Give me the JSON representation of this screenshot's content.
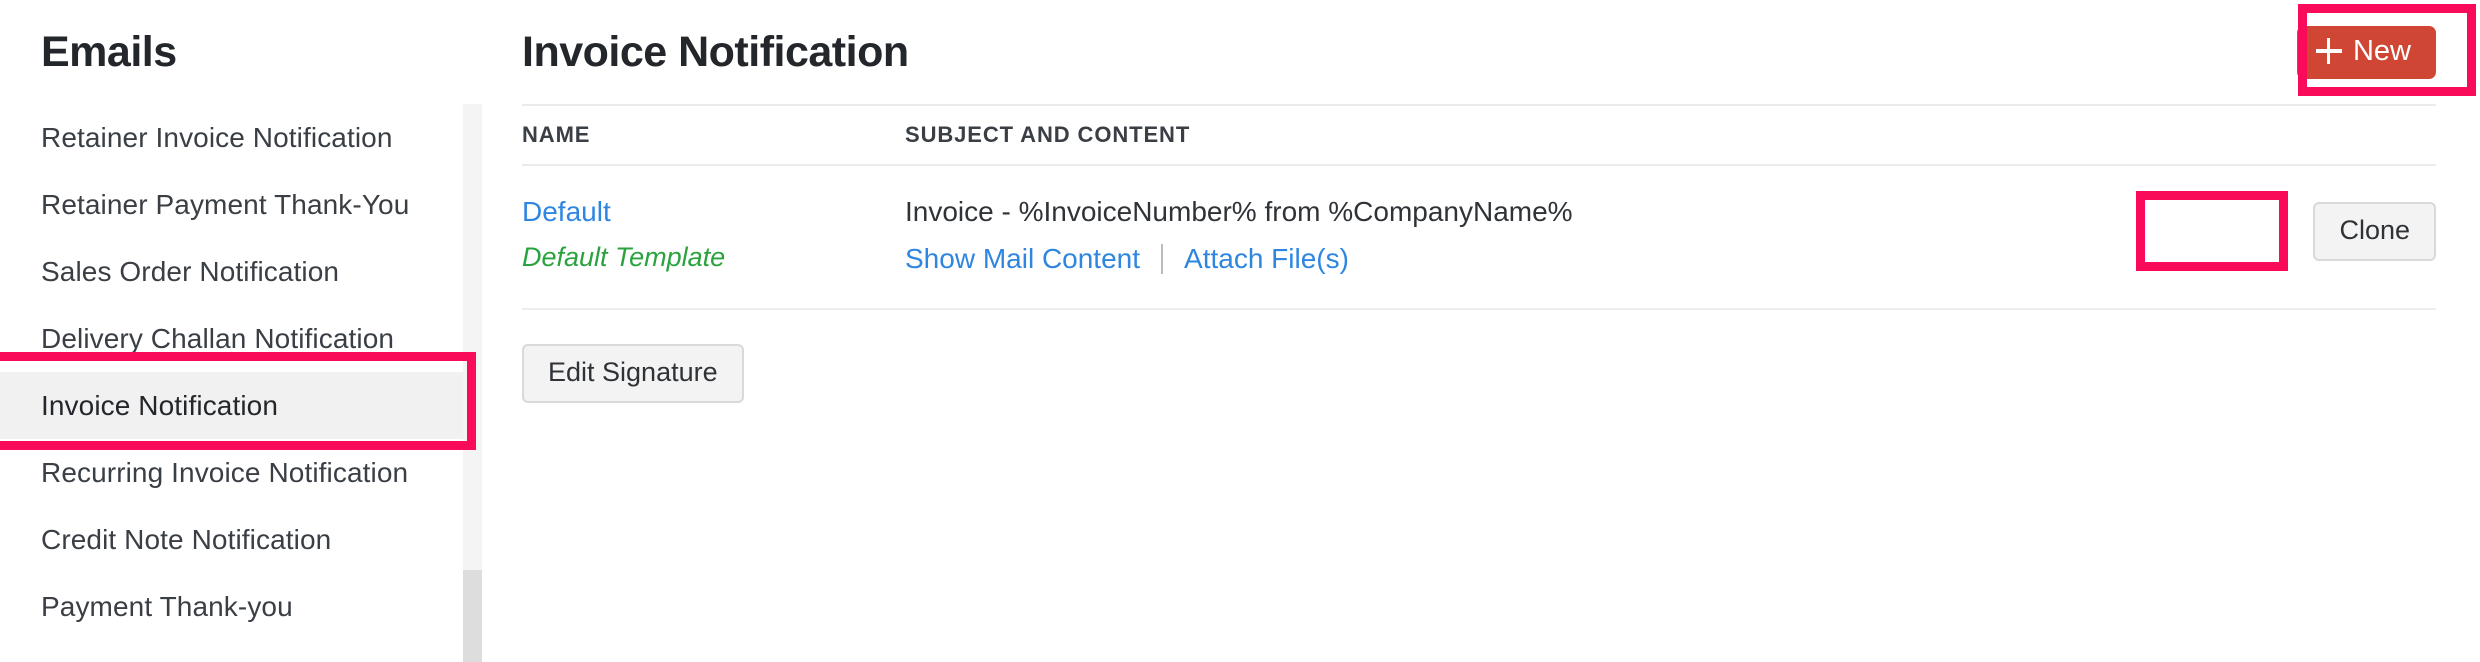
{
  "sidebar": {
    "title": "Emails",
    "items": [
      {
        "label": "Retainer Invoice Notification",
        "selected": false
      },
      {
        "label": "Retainer Payment Thank-You",
        "selected": false
      },
      {
        "label": "Sales Order Notification",
        "selected": false
      },
      {
        "label": "Delivery Challan Notification",
        "selected": false
      },
      {
        "label": "Invoice Notification",
        "selected": true
      },
      {
        "label": "Recurring Invoice Notification",
        "selected": false
      },
      {
        "label": "Credit Note Notification",
        "selected": false
      },
      {
        "label": "Payment Thank-you",
        "selected": false
      }
    ]
  },
  "header": {
    "title": "Invoice Notification",
    "new_button": "New",
    "new_icon": "plus-icon"
  },
  "table": {
    "columns": {
      "name": "NAME",
      "subject": "SUBJECT AND CONTENT",
      "action": ""
    },
    "rows": [
      {
        "name": "Default",
        "badge": "Default Template",
        "subject": "Invoice - %InvoiceNumber% from %CompanyName%",
        "link_show_mail": "Show Mail Content",
        "link_attach": "Attach File(s)",
        "action": "Clone"
      }
    ]
  },
  "footer": {
    "edit_signature": "Edit Signature"
  },
  "colors": {
    "accent_new_button": "#cf4634",
    "highlight_box": "#fa0b59",
    "link_blue": "#2f86e0",
    "badge_green": "#2aa33f",
    "selected_row_bg": "#f1f1f1"
  }
}
